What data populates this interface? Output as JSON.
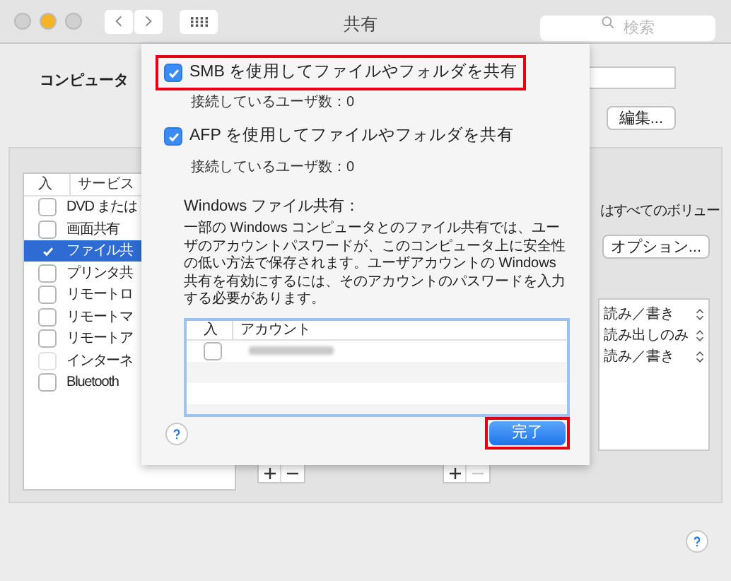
{
  "window": {
    "title": "共有",
    "search_placeholder": "検索"
  },
  "computer_label": "コンピュータ",
  "edit_button": "編集...",
  "services": {
    "columns": [
      "入",
      "サービス"
    ],
    "items": [
      {
        "label": "DVD または",
        "checked": false,
        "selected": false,
        "disabled": false
      },
      {
        "label": "画面共有",
        "checked": false,
        "selected": false,
        "disabled": false
      },
      {
        "label": "ファイル共",
        "checked": true,
        "selected": true,
        "disabled": false
      },
      {
        "label": "プリンタ共",
        "checked": false,
        "selected": false,
        "disabled": false
      },
      {
        "label": "リモートロ",
        "checked": false,
        "selected": false,
        "disabled": false
      },
      {
        "label": "リモートマ",
        "checked": false,
        "selected": false,
        "disabled": false
      },
      {
        "label": "リモートア",
        "checked": false,
        "selected": false,
        "disabled": false
      },
      {
        "label": "インターネ",
        "checked": false,
        "selected": false,
        "disabled": true
      },
      {
        "label": "Bluetooth",
        "checked": false,
        "selected": false,
        "disabled": false
      }
    ]
  },
  "access_note": "はすべてのボリュー",
  "options_button": "オプション...",
  "permissions": [
    "読み／書き",
    "読み出しのみ",
    "読み／書き"
  ],
  "add_remove": [
    {
      "remove_disabled": false
    },
    {
      "remove_disabled": true
    }
  ],
  "sheet": {
    "options": [
      {
        "label": "SMB を使用してファイルやフォルダを共有",
        "checked": true,
        "highlighted": true,
        "status": "接続しているユーザ数：0"
      },
      {
        "label": "AFP を使用してファイルやフォルダを共有",
        "checked": true,
        "highlighted": false,
        "status": "接続しているユーザ数：0"
      }
    ],
    "windows_heading": "Windows ファイル共有：",
    "windows_note": "一部の Windows コンピュータとのファイル共有では、ユーザのアカウントパスワードが、このコンピュータ上に安全性の低い方法で保存されます。ユーザアカウントの Windows 共有を有効にするには、そのアカウントのパスワードを入力する必要があります。",
    "accounts": {
      "columns": [
        "入",
        "アカウント"
      ],
      "rows": [
        {
          "checked": false
        }
      ]
    },
    "done_button": {
      "label": "完了",
      "highlighted": true
    }
  }
}
